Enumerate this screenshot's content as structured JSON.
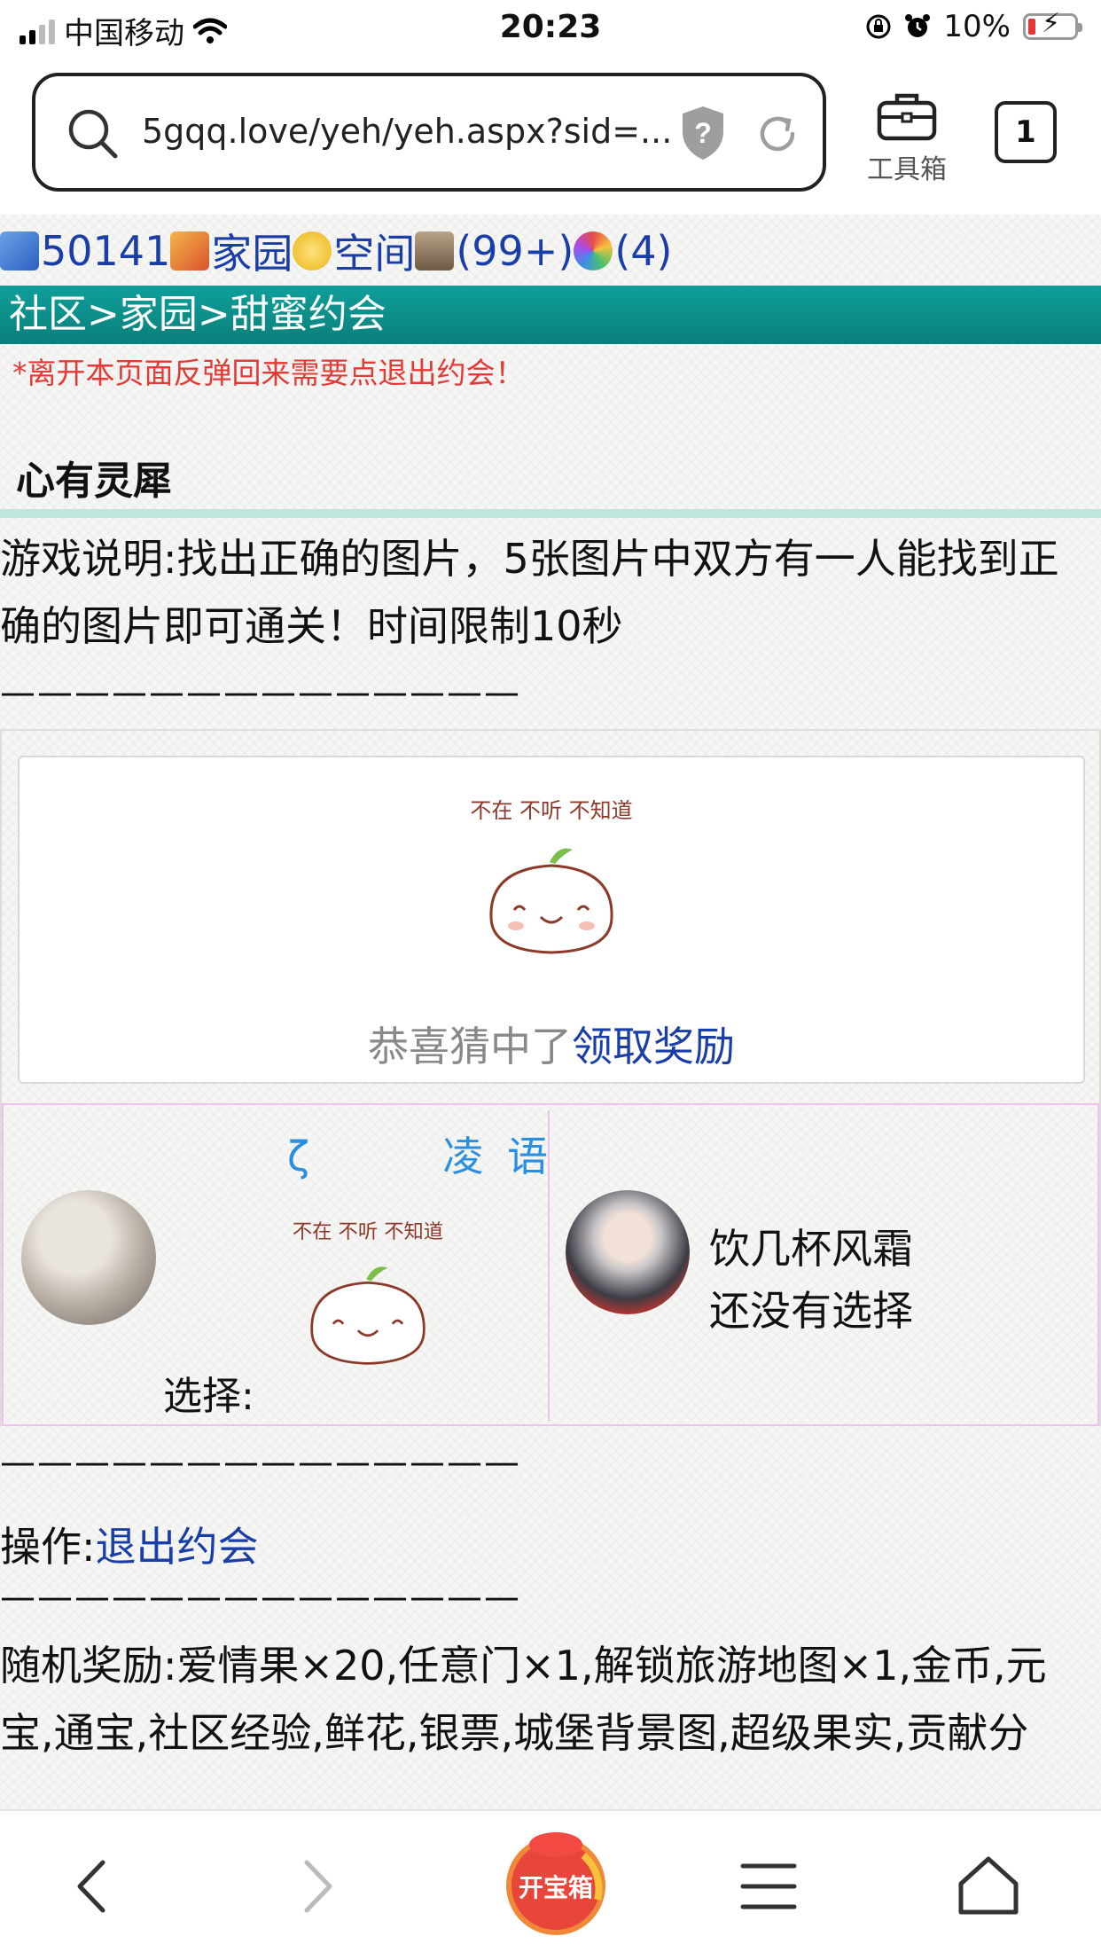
{
  "status_bar": {
    "carrier": "中国移动",
    "time": "20:23",
    "battery": "10%"
  },
  "browser": {
    "url": "5gqq.love/yeh/yeh.aspx?sid=...",
    "toolbox_label": "工具箱",
    "tab_count": "1"
  },
  "nav": {
    "id_number": "50141",
    "home": "家园",
    "space": "空间",
    "messages": "(99+)",
    "notices": "(4)"
  },
  "breadcrumb": "社区>家园>甜蜜约会",
  "warning": "*离开本页面反弹回来需要点退出约会！",
  "section_title": "心有灵犀",
  "description": "游戏说明:找出正确的图片，5张图片中双方有一人能找到正确的图片即可通关！时间限制10秒",
  "divider": "——————————————",
  "sticker_text": "不在 不听 不知道",
  "result": {
    "text": "恭喜猜中了",
    "link": "领取奖励"
  },
  "player1": {
    "name": "ζ       凌 语",
    "choice_label": "选择:"
  },
  "player2": {
    "name": "饮几杯风霜",
    "status": "还没有选择"
  },
  "action": {
    "label": "操作:",
    "link": "退出约会"
  },
  "reward": "随机奖励:爱情果×20,任意门×1,解锁旅游地图×1,金币,元宝,通宝,社区经验,鲜花,银票,城堡背景图,超级果实,贡献分",
  "bottom": {
    "treasure_label": "开宝箱"
  },
  "colors": {
    "header_bar": "#0f9f9a",
    "link": "#1a3ea8",
    "warning": "#e53935",
    "player_name": "#2a8fe0",
    "panel_border": "#f0c0ee"
  }
}
